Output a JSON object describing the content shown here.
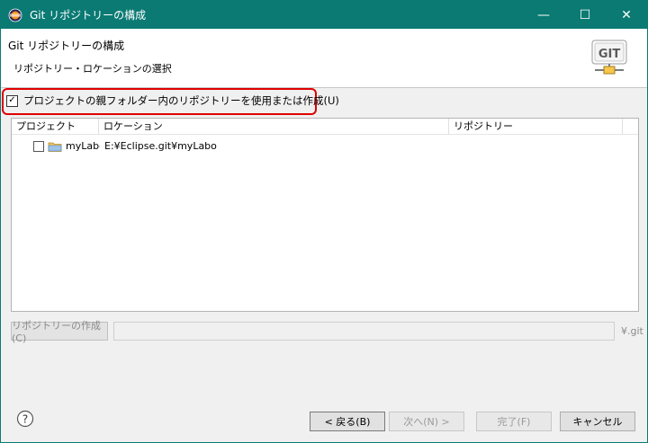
{
  "window": {
    "title": "Git リポジトリーの構成",
    "controls": {
      "minimize": "—",
      "maximize": "☐",
      "close": "✕"
    }
  },
  "header": {
    "title": "Git リポジトリーの構成",
    "subtitle": "リポジトリー・ロケーションの選択",
    "logo_text": "GIT"
  },
  "option": {
    "checked": true,
    "label": "プロジェクトの親フォルダー内のリポジトリーを使用または作成(U)"
  },
  "table": {
    "columns": [
      "プロジェクト",
      "ロケーション",
      "リポジトリー"
    ],
    "rows": [
      {
        "checked": false,
        "project": "myLabo",
        "location": "E:¥Eclipse.git¥myLabo",
        "repository": ""
      }
    ]
  },
  "create_repo": {
    "button_label": "リポジトリーの作成(C)",
    "suffix": "¥.git"
  },
  "buttons": {
    "back": "< 戻る(B)",
    "next": "次へ(N) >",
    "finish": "完了(F)",
    "cancel": "キャンセル"
  },
  "colors": {
    "titlebar": "#0a7a73",
    "highlight": "#e00000"
  }
}
